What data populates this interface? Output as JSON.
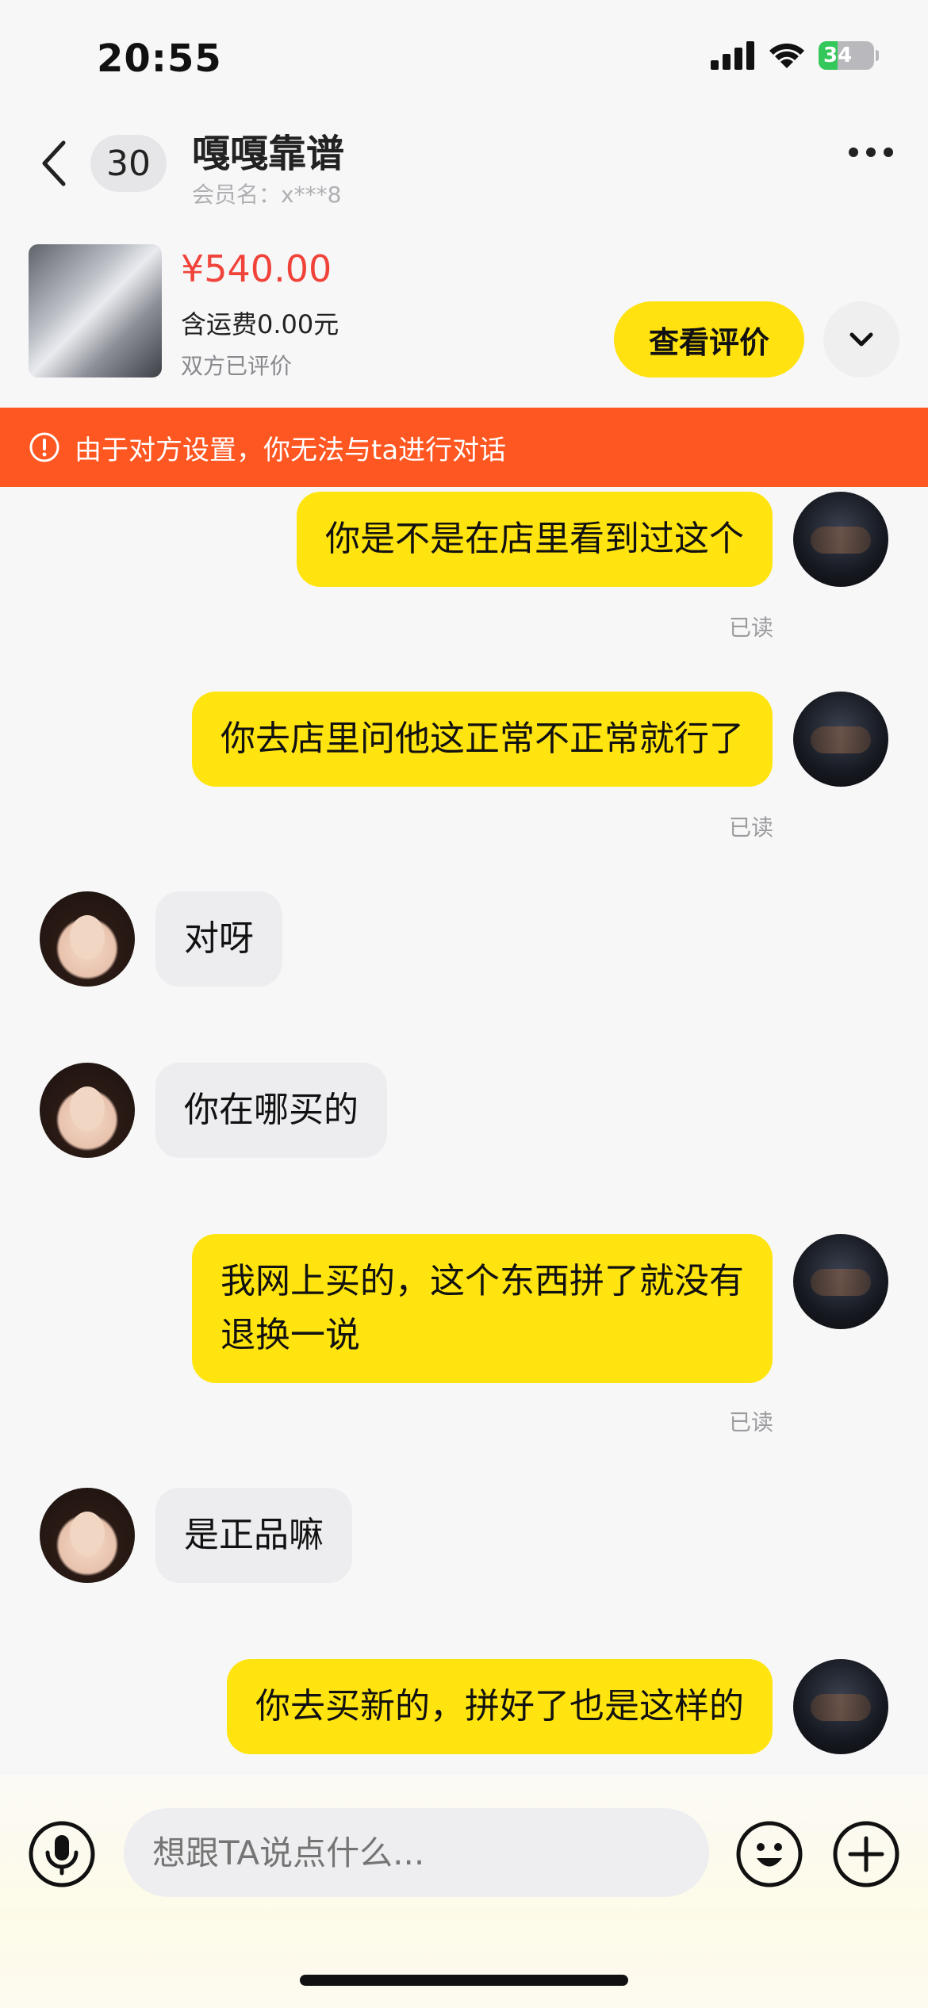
{
  "status_bar": {
    "time": "20:55",
    "battery": "34"
  },
  "header": {
    "unread_count": "30",
    "title": "嘎嘎靠谱",
    "member_name": "会员名：x***8"
  },
  "product": {
    "price": "¥540.00",
    "shipping": "含运费0.00元",
    "review_status": "双方已评价",
    "view_reviews_label": "查看评价"
  },
  "notice": "由于对方设置，你无法与ta进行对话",
  "messages": [
    {
      "from": "me",
      "text": "你是不是在店里看到过这个",
      "status": "已读"
    },
    {
      "from": "me",
      "text": "你去店里问他这正常不正常就行了",
      "status": "已读"
    },
    {
      "from": "her",
      "text": "对呀"
    },
    {
      "from": "her",
      "text": "你在哪买的"
    },
    {
      "from": "me",
      "text": "我网上买的，这个东西拼了就没有\n退换一说",
      "status": "已读"
    },
    {
      "from": "her",
      "text": "是正品嘛"
    },
    {
      "from": "me",
      "text": "你去买新的，拼好了也是这样的"
    }
  ],
  "composer": {
    "placeholder": "想跟TA说点什么..."
  },
  "icons": [
    "back-icon",
    "more-icon",
    "alert-icon",
    "chevron-down-icon",
    "microphone-icon",
    "emoji-icon",
    "plus-icon",
    "signal-icon",
    "wifi-icon",
    "battery-icon"
  ],
  "colors": {
    "accent_yellow": "#ffe40f",
    "notice_orange": "#ff5722",
    "price_red": "#f0433a"
  }
}
